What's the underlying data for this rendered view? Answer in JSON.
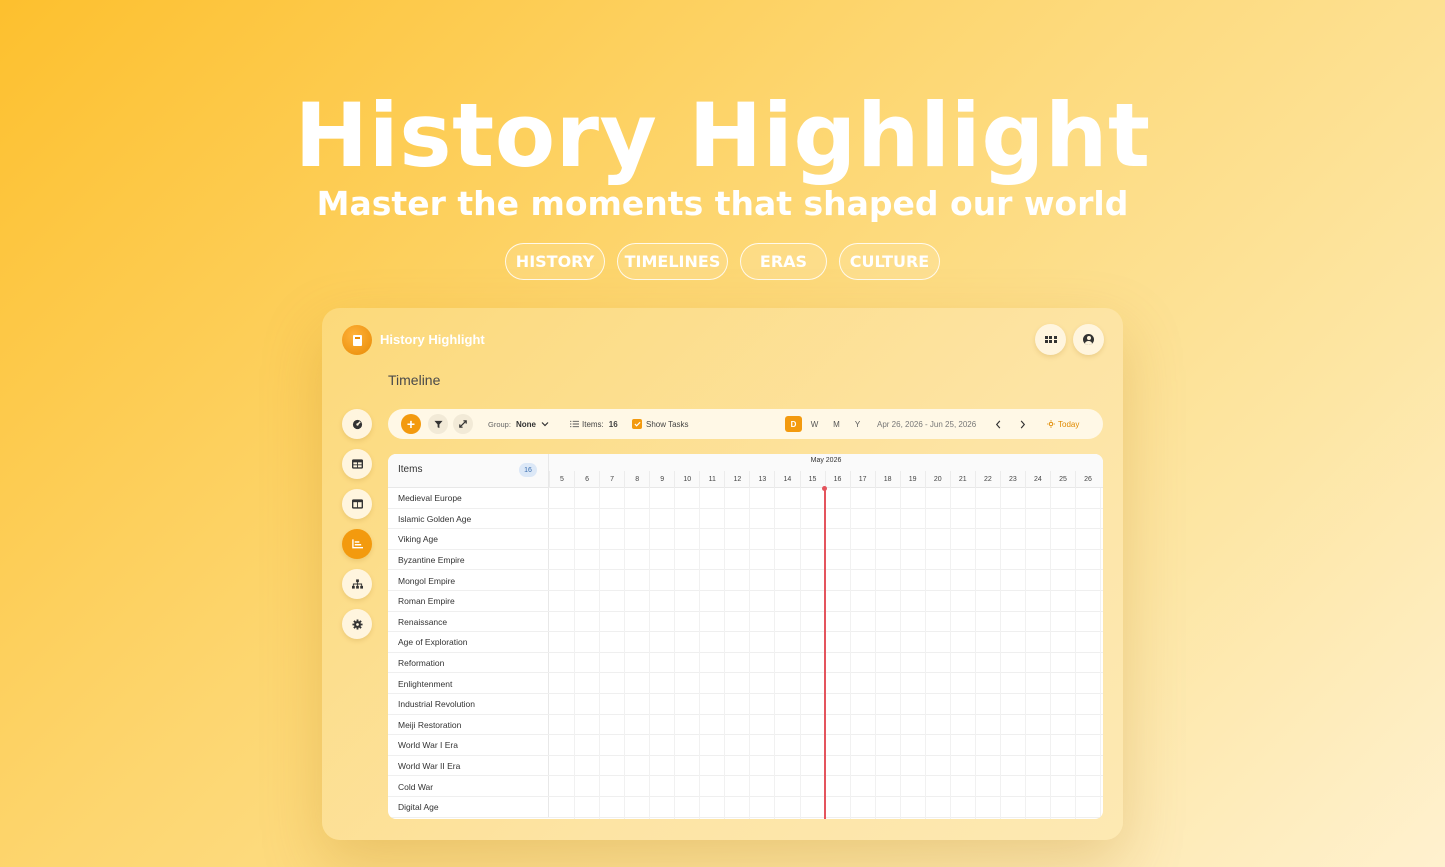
{
  "hero": {
    "title": "History Highlight",
    "subtitle": "Master the moments that shaped our world",
    "tags": [
      "HISTORY",
      "TIMELINES",
      "ERAS",
      "CULTURE"
    ]
  },
  "app": {
    "name": "History Highlight",
    "page_title": "Timeline",
    "accent_color": "#f39a0e"
  },
  "sidebar": {
    "items": [
      {
        "icon": "dashboard-icon",
        "active": false
      },
      {
        "icon": "table-icon",
        "active": false
      },
      {
        "icon": "board-icon",
        "active": false
      },
      {
        "icon": "chart-icon",
        "active": true
      },
      {
        "icon": "hierarchy-icon",
        "active": false
      },
      {
        "icon": "settings-icon",
        "active": false
      }
    ]
  },
  "toolbar": {
    "add_label": "+",
    "group_label": "Group:",
    "group_value": "None",
    "items_label": "Items:",
    "items_count": "16",
    "show_tasks_label": "Show Tasks",
    "show_tasks_checked": true,
    "view_modes": [
      "D",
      "W",
      "M",
      "Y"
    ],
    "active_view": "D",
    "date_range": "Apr 26, 2026 - Jun 25, 2026",
    "today_label": "Today"
  },
  "timeline": {
    "items_header": "Items",
    "items_count": "16",
    "month_label": "May 2026",
    "days": [
      "5",
      "6",
      "7",
      "8",
      "9",
      "10",
      "11",
      "12",
      "13",
      "14",
      "15",
      "16",
      "17",
      "18",
      "19",
      "20",
      "21",
      "22",
      "23",
      "24",
      "25",
      "26"
    ],
    "today_day": "16",
    "rows": [
      "Medieval Europe",
      "Islamic Golden Age",
      "Viking Age",
      "Byzantine Empire",
      "Mongol Empire",
      "Roman Empire",
      "Renaissance",
      "Age of Exploration",
      "Reformation",
      "Enlightenment",
      "Industrial Revolution",
      "Meiji Restoration",
      "World War I Era",
      "World War II Era",
      "Cold War",
      "Digital Age"
    ]
  }
}
